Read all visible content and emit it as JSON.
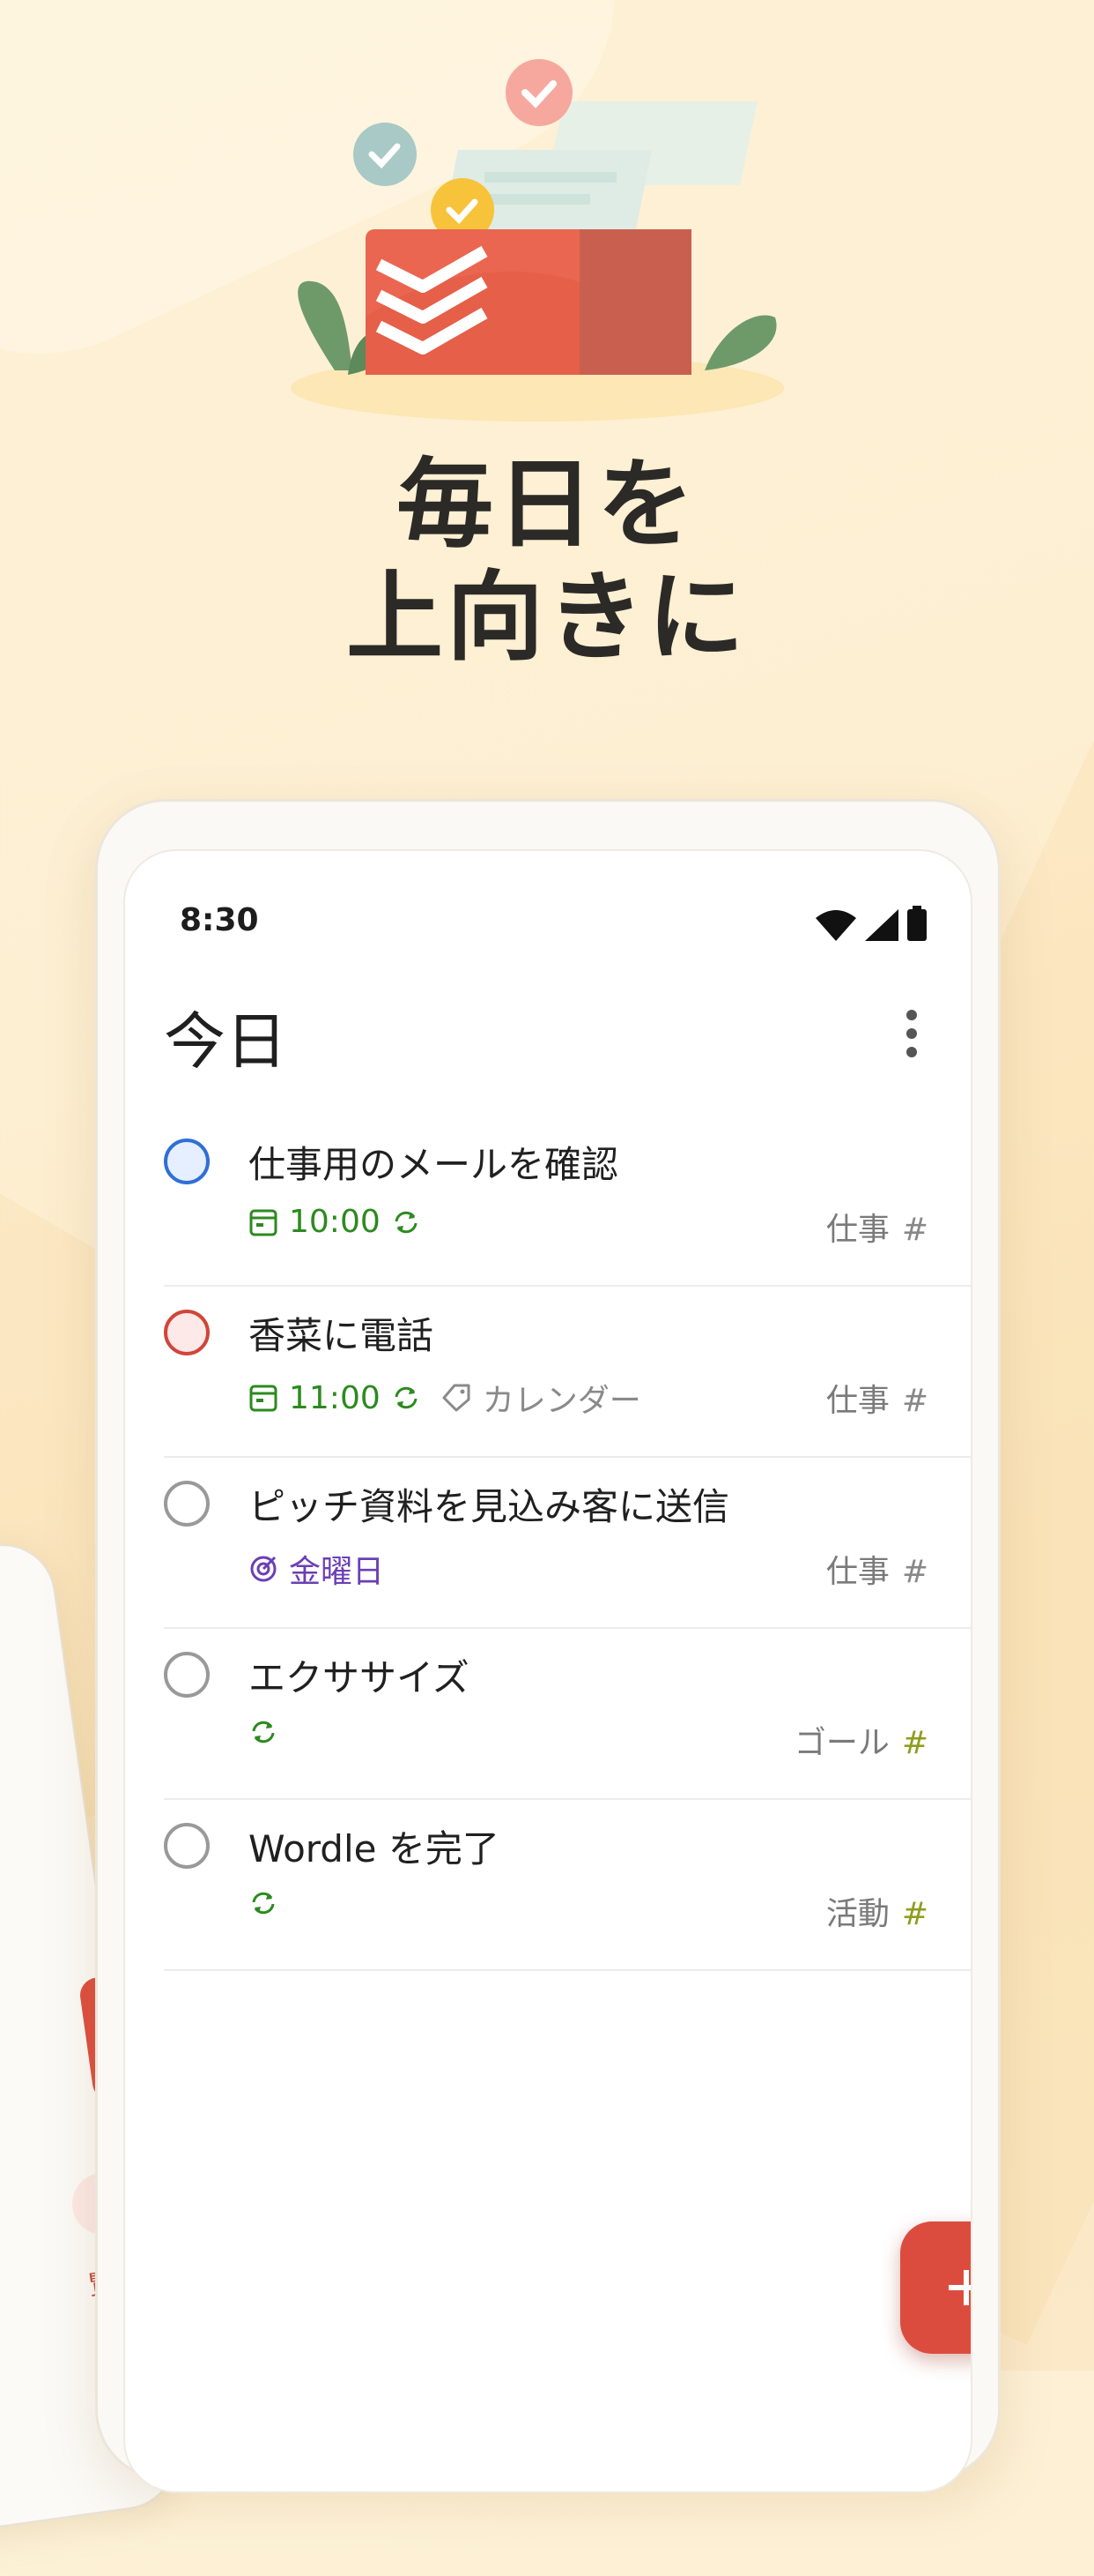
{
  "headline": {
    "line1": "毎日を",
    "line2": "上向きに"
  },
  "status_bar": {
    "time": "8:30"
  },
  "page": {
    "title": "今日"
  },
  "tasks": [
    {
      "title": "仕事用のメールを確認",
      "time": "10:00",
      "recurring": true,
      "label": "",
      "deadline": "",
      "project": "仕事",
      "check_style": "blue"
    },
    {
      "title": "香菜に電話",
      "time": "11:00",
      "recurring": true,
      "label": "カレンダー",
      "deadline": "",
      "project": "仕事",
      "check_style": "red"
    },
    {
      "title": "ピッチ資料を見込み客に送信",
      "time": "",
      "recurring": false,
      "label": "",
      "deadline": "金曜日",
      "project": "仕事",
      "check_style": "grey"
    },
    {
      "title": "エクササイズ",
      "time": "",
      "recurring": true,
      "label": "",
      "deadline": "",
      "project": "ゴール",
      "check_style": "grey"
    },
    {
      "title": "Wordle を完了",
      "time": "",
      "recurring": true,
      "label": "",
      "deadline": "",
      "project": "活動",
      "check_style": "grey"
    }
  ],
  "back_phone": {
    "partial_label": "覧"
  },
  "colors": {
    "accent": "#dc4c3e",
    "time_green": "#2c8a1f",
    "deadline_purple": "#6b3fb5",
    "check_blue": "#2f6fd6",
    "check_red": "#d1453b"
  },
  "icons": {
    "fab": "plus-icon",
    "more": "more-vertical-icon",
    "calendar": "calendar-icon",
    "repeat": "repeat-icon",
    "label": "tag-icon",
    "deadline": "target-icon"
  }
}
